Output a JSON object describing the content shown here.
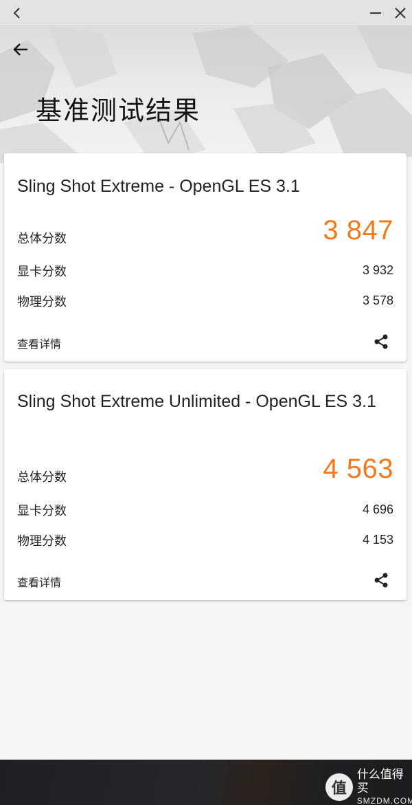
{
  "window": {
    "back_icon": "chevron-left-icon",
    "minimize_icon": "minimize-icon",
    "close_icon": "close-icon"
  },
  "header": {
    "back_icon": "arrow-left-icon",
    "title": "基准测试结果"
  },
  "results": [
    {
      "title": "Sling Shot Extreme - OpenGL ES 3.1",
      "overall_label": "总体分数",
      "overall_value": "3 847",
      "graphics_label": "显卡分数",
      "graphics_value": "3 932",
      "physics_label": "物理分数",
      "physics_value": "3 578",
      "details_label": "查看详情",
      "share_icon": "share-icon"
    },
    {
      "title": "Sling Shot Extreme Unlimited - OpenGL ES 3.1",
      "overall_label": "总体分数",
      "overall_value": "4 563",
      "graphics_label": "显卡分数",
      "graphics_value": "4 696",
      "physics_label": "物理分数",
      "physics_value": "4 153",
      "details_label": "查看详情",
      "share_icon": "share-icon"
    }
  ],
  "colors": {
    "score_accent": "#f07a1e",
    "bottom_bar": "#1d1f23"
  },
  "watermark": {
    "badge": "值",
    "name": "什么值得买",
    "domain": "SMZDM.COM"
  }
}
